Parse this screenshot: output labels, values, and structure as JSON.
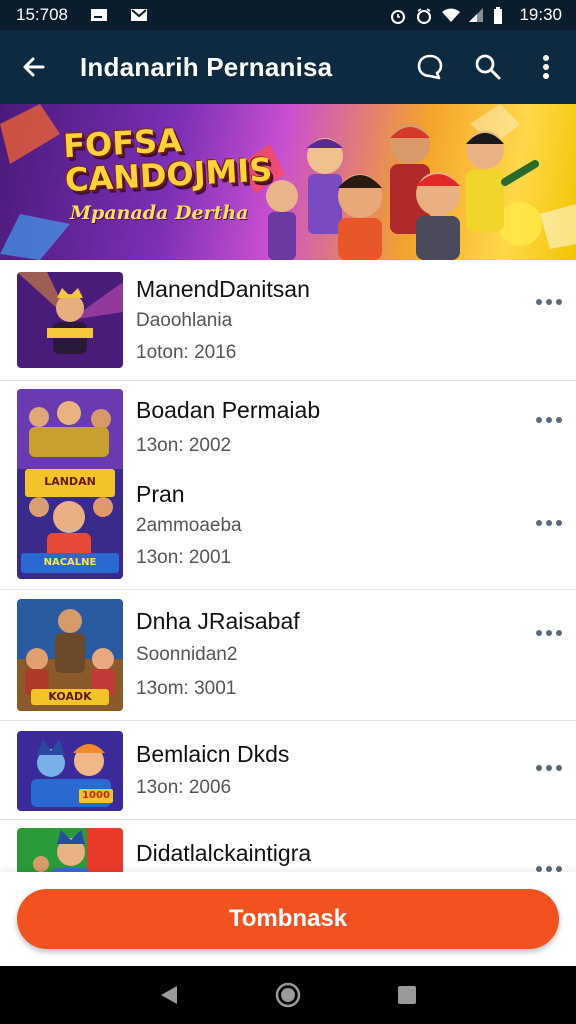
{
  "status_bar": {
    "time_left": "15:708",
    "time_right": "19:30"
  },
  "app_bar": {
    "title": "Indanarih Pernanisa"
  },
  "banner": {
    "title_line1": "FOFSA",
    "title_line2": "CANDOJMIS",
    "subtitle": "Mpanada Dertha"
  },
  "items": [
    {
      "title": "ManendDanitsan",
      "subtitle": "Daoohlania",
      "date": "1oton: 2016"
    },
    {
      "title": "Boadan Permaiab",
      "subtitle": "",
      "date": "13on: 2002"
    },
    {
      "title": "Pran",
      "subtitle": "2ammoaeba",
      "date": "13on: 2001"
    },
    {
      "title": "Dnha JRaisabaf",
      "subtitle": "Soonnidan2",
      "date": "13om: 3001"
    },
    {
      "title": "Bemlaicn Dkds",
      "subtitle": "",
      "date": "13on: 2006"
    },
    {
      "title": "Didatlalckaintigra",
      "subtitle": "",
      "date": ""
    }
  ],
  "thumb_labels": {
    "t2": "LANDAN",
    "t3": "NACALNE",
    "t4": "KOADK",
    "t5": "1000"
  },
  "primary_button": {
    "label": "Tombnask"
  },
  "colors": {
    "app_bar": "#0e2a41",
    "accent": "#f2521f"
  }
}
